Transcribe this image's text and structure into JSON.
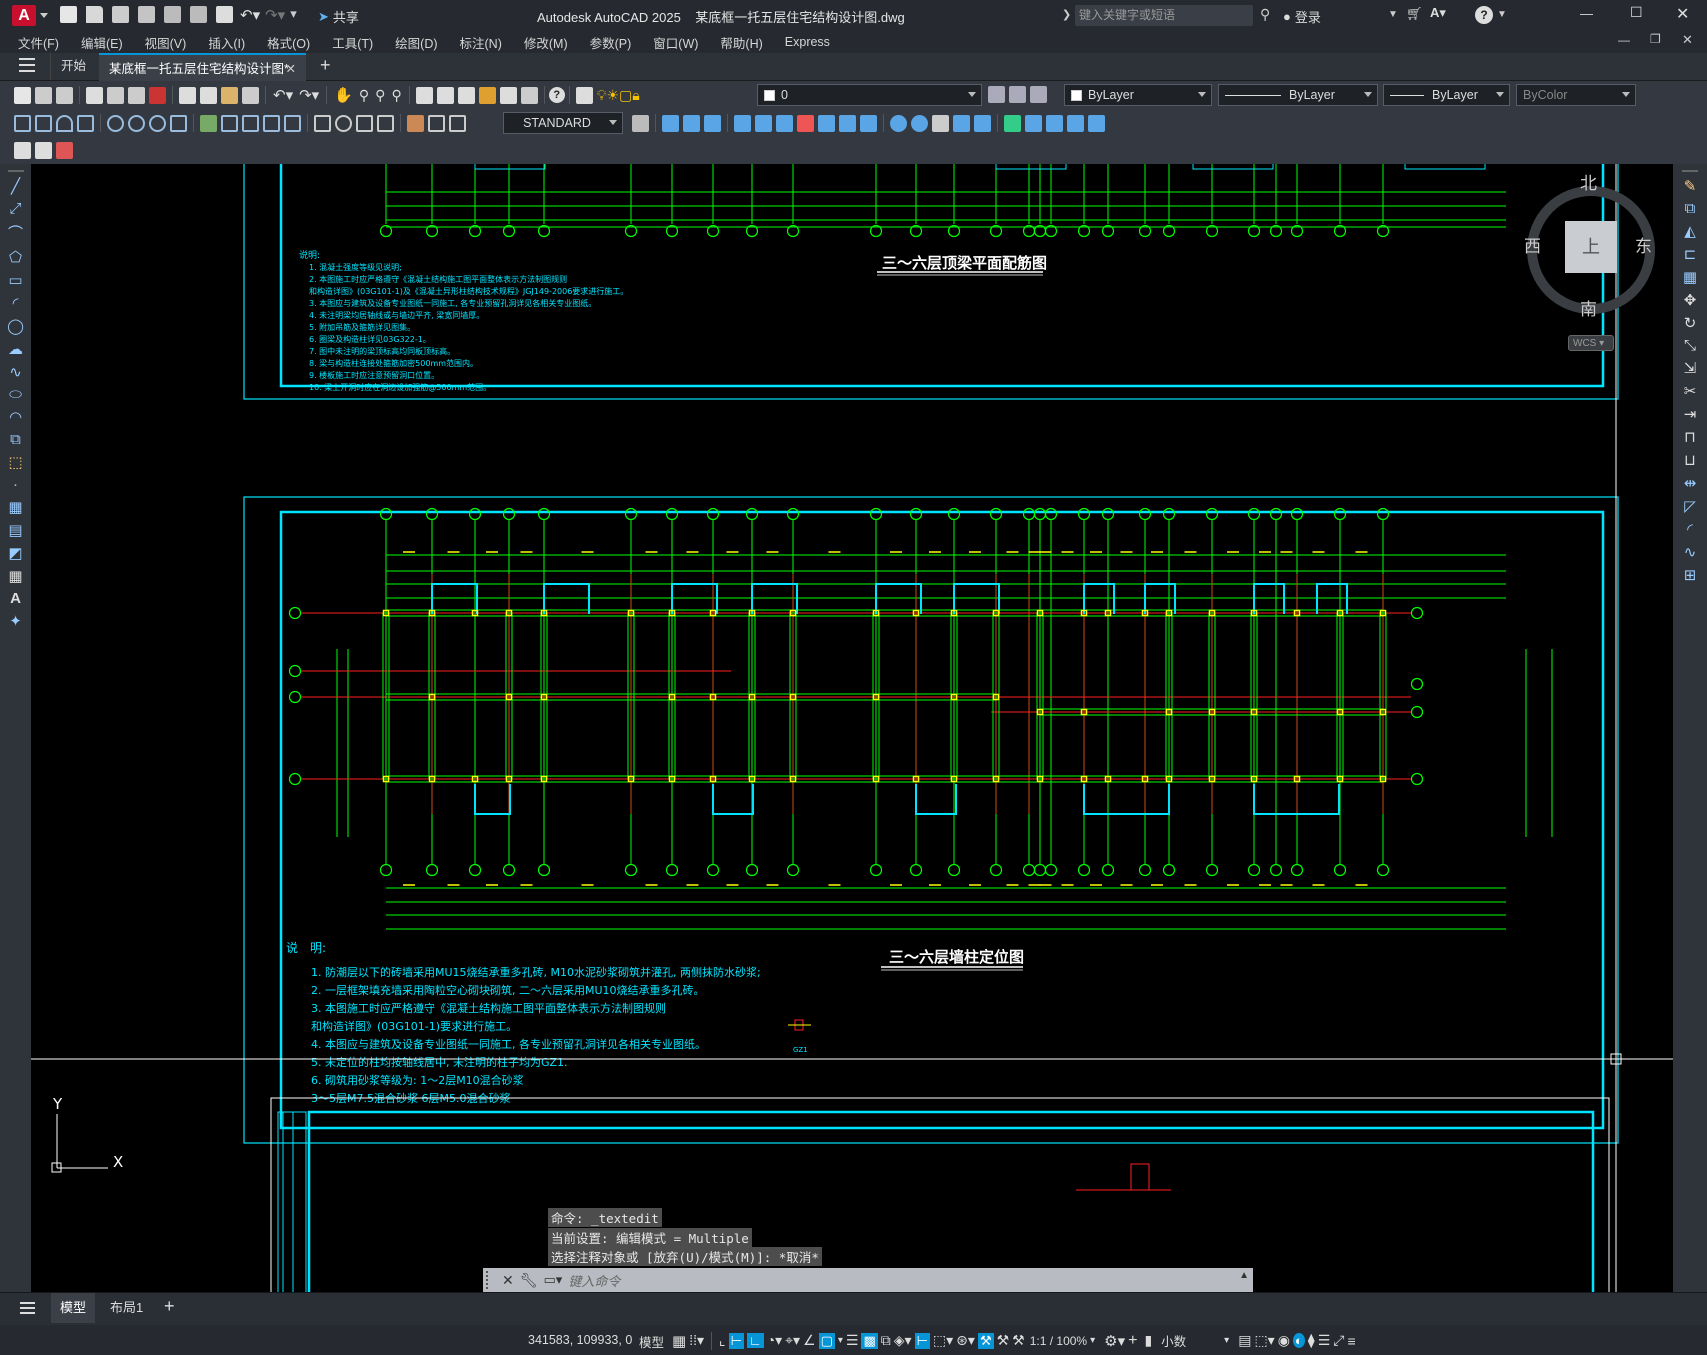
{
  "app": {
    "title": "Autodesk AutoCAD 2025",
    "file_title": "某底框一托五层住宅结构设计图.dwg",
    "share_label": "共享",
    "search_placeholder": "键入关键字或短语",
    "login_label": "登录"
  },
  "menu": [
    "文件(F)",
    "编辑(E)",
    "视图(V)",
    "插入(I)",
    "格式(O)",
    "工具(T)",
    "绘图(D)",
    "标注(N)",
    "修改(M)",
    "参数(P)",
    "窗口(W)",
    "帮助(H)",
    "Express"
  ],
  "doc_tabs": {
    "start": "开始",
    "active": "某底框一托五层住宅结构设计图*"
  },
  "properties": {
    "layer": "0",
    "color": "ByLayer",
    "linetype": "ByLayer",
    "lineweight": "ByLayer",
    "plotstyle": "ByColor",
    "textstyle": "STANDARD"
  },
  "viewcube": {
    "north": "北",
    "south": "南",
    "east": "东",
    "west": "西",
    "top": "上",
    "wcs": "WCS"
  },
  "drawing": {
    "title_top": "三～六层顶梁平面配筋图",
    "title_bottom": "三～六层墙柱定位图",
    "notes_header": "说　明:",
    "notes_top_header": "说明:",
    "notes_top": [
      "1. 混凝土强度等级见说明;",
      "2. 本图施工时应严格遵守《混凝土结构施工图平面整体表示方法制图规则",
      "   和构造详图》(03G101-1)及《混凝土异形柱结构技术规程》JGJ149-2006要求进行施工。",
      "3. 本图应与建筑及设备专业图纸一同施工, 各专业预留孔洞详见各相关专业图纸。",
      "4. 未注明梁均居轴线或与墙边平齐, 梁宽同墙厚。",
      "5. 附加吊筋及箍筋详见图集。",
      "6. 圈梁及构造柱详见03G322-1。",
      "7. 图中未注明的梁顶标高均同板顶标高。",
      "8. 梁与构造柱连接处箍筋加密500mm范围内。",
      "9. 楼板施工时应注意预留洞口位置。",
      "10. 梁上开洞时应在洞边设加强筋@500mm范围。"
    ],
    "notes_bottom": [
      "1. 防潮层以下的砖墙采用MU15烧结承重多孔砖, M10水泥砂浆砌筑并灌孔, 两侧抹防水砂浆;",
      "2. 一层框架填充墙采用陶粒空心砌块砌筑, 二～六层采用MU10烧结承重多孔砖。",
      "3. 本图施工时应严格遵守《混凝土结构施工图平面整体表示方法制图规则",
      "   和构造详图》(03G101-1)要求进行施工。",
      "4. 本图应与建筑及设备专业图纸一同施工, 各专业预留孔洞详见各相关专业图纸。",
      "5. 未定位的柱均按轴线居中, 未注明的柱子均为GZ1.",
      "6. 砌筑用砂浆等级为: 1～2层M10混合砂浆",
      "                  3～5层M7.5混合砂浆  6层M5.0混合砂浆"
    ],
    "gz_label": "GZ1",
    "ucs_x": "X",
    "ucs_y": "Y"
  },
  "command": {
    "line1": "命令: _textedit",
    "line2": "当前设置: 编辑模式 = Multiple",
    "line3": "选择注释对象或 [放弃(U)/模式(M)]: *取消*",
    "placeholder": "键入命令"
  },
  "layout_tabs": [
    "模型",
    "布局1"
  ],
  "status": {
    "coords": "341583, 109933, 0",
    "mode": "模型",
    "scale": "1:1 / 100%",
    "units": "小数"
  },
  "colors": {
    "cyan": "#00e5ff",
    "green": "#00ff00",
    "yellow": "#ffff00",
    "red": "#ff2020",
    "white": "#ffffff",
    "accent": "#0696d7"
  }
}
